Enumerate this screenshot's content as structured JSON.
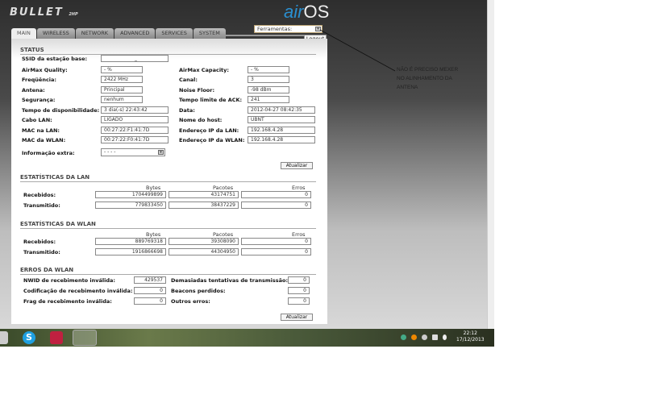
{
  "header": {
    "logo": "BULLET",
    "logo_sub": "2HP",
    "brand_air": "air",
    "brand_os": "OS",
    "tools_label": "Ferramentas:",
    "logout": "Logout"
  },
  "tabs": [
    "MAIN",
    "WIRELESS",
    "NETWORK",
    "ADVANCED",
    "SERVICES",
    "SYSTEM"
  ],
  "status": {
    "title": "STATUS",
    "ssid_label": "SSID da estação base:",
    "ssid": "_",
    "left": [
      {
        "label": "AirMax Quality:",
        "value": "- %"
      },
      {
        "label": "Freqüência:",
        "value": "2422 MHz"
      },
      {
        "label": "Antena:",
        "value": "Principal"
      },
      {
        "label": "Segurança:",
        "value": "nenhum"
      },
      {
        "label": "Tempo de disponibilidade:",
        "value": "3 dia(-s) 22:43:42"
      },
      {
        "label": "Cabo LAN:",
        "value": "LIGADO"
      },
      {
        "label": "MAC na LAN:",
        "value": "00:27:22:F1:41:7D"
      },
      {
        "label": "MAC da WLAN:",
        "value": "00:27:22:F0:41:7D"
      }
    ],
    "right": [
      {
        "label": "AirMax Capacity:",
        "value": "- %"
      },
      {
        "label": "Canal:",
        "value": "3"
      },
      {
        "label": "Noise Floor:",
        "value": "-98 dBm"
      },
      {
        "label": "Tempo limite de ACK:",
        "value": "241"
      },
      {
        "label": "Data:",
        "value": "2012-04-27 08:42:35"
      },
      {
        "label": "Nome do host:",
        "value": "UBNT"
      },
      {
        "label": "Endereço IP da LAN:",
        "value": "192.168.4.28"
      },
      {
        "label": "Endereço IP da WLAN:",
        "value": "192.168.4.28"
      }
    ],
    "extra_label": "Informação extra:",
    "extra_value": "- - - -",
    "refresh": "Atualizar"
  },
  "cols": {
    "bytes": "Bytes",
    "packets": "Pacotes",
    "errors": "Erros"
  },
  "lan": {
    "title": "ESTATÍSTICAS DA LAN",
    "rows": [
      {
        "label": "Recebidos:",
        "bytes": "1704499899",
        "packets": "43174751",
        "errors": "0"
      },
      {
        "label": "Transmitido:",
        "bytes": "779833450",
        "packets": "38437229",
        "errors": "0"
      }
    ]
  },
  "wlan": {
    "title": "ESTATÍSTICAS DA WLAN",
    "rows": [
      {
        "label": "Recebidos:",
        "bytes": "889769318",
        "packets": "39308090",
        "errors": "0"
      },
      {
        "label": "Transmitido:",
        "bytes": "1916866698",
        "packets": "44304950",
        "errors": "0"
      }
    ]
  },
  "errors": {
    "title": "ERROS DA WLAN",
    "left": [
      {
        "label": "NWID de recebimento inválida:",
        "value": "429537"
      },
      {
        "label": "Codificação de recebimento inválida:",
        "value": "0"
      },
      {
        "label": "Frag de recebimento inválida:",
        "value": "0"
      }
    ],
    "right": [
      {
        "label": "Demasiadas tentativas de transmissão:",
        "value": "0"
      },
      {
        "label": "Beacons perdidos:",
        "value": "0"
      },
      {
        "label": "Outros erros:",
        "value": "0"
      }
    ],
    "refresh": "Atualizar"
  },
  "annotation": [
    "NÃO É PRECISO MEXER",
    "NO ALINHAMENTO DA",
    "ANTENA"
  ],
  "taskbar": {
    "time": "22:12",
    "date": "17/12/2013"
  }
}
